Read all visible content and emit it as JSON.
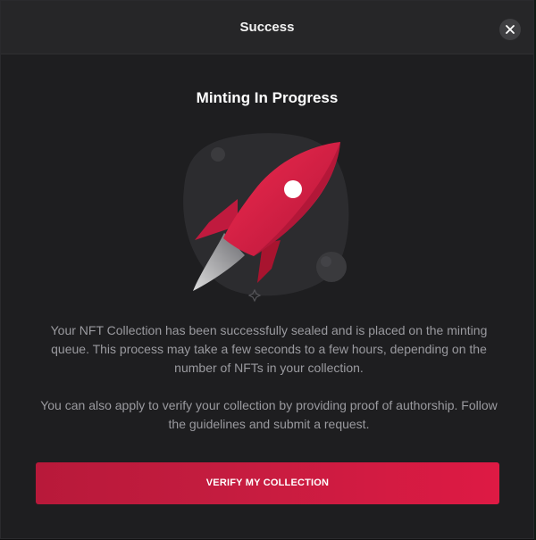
{
  "modal": {
    "title": "Success",
    "close_icon": "close-icon",
    "subtitle": "Minting In Progress",
    "paragraph_1": "Your NFT Collection has been successfully sealed and is placed on the minting queue. This process may take a few seconds to a few hours, depending on the number of NFTs in your collection.",
    "paragraph_2": "You can also apply to verify your collection by providing proof of authorship. Follow the guidelines and submit a request.",
    "verify_button_label": "VERIFY MY COLLECTION"
  },
  "illustration": {
    "icon": "rocket-icon"
  },
  "colors": {
    "accent": "#d81b42",
    "background": "#1e1e20",
    "header": "#262628"
  }
}
